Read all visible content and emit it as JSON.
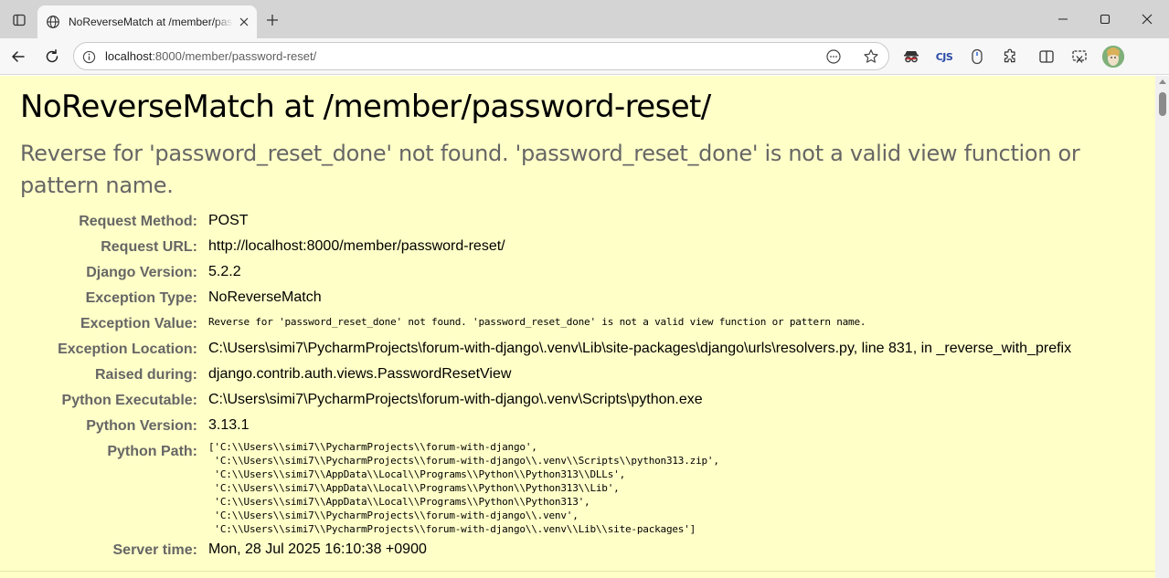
{
  "browser": {
    "tab": {
      "title": "NoReverseMatch at /member/password-reset/"
    },
    "address_bar": {
      "host": "localhost",
      "path": ":8000/member/password-reset/"
    },
    "icons": {
      "tab_actions": "tab-actions-icon",
      "favicon": "globe-icon",
      "close_tab": "close-icon",
      "new_tab": "plus-icon",
      "minimize": "minimize-icon",
      "maximize": "maximize-icon",
      "close_window": "close-icon",
      "back": "back-arrow-icon",
      "refresh": "refresh-icon",
      "info": "info-icon",
      "reader": "reader-mode-icon",
      "favorite": "star-icon",
      "extensions": "puzzle-icon",
      "split": "split-screen-icon",
      "screenshot": "screenshot-icon"
    },
    "extension_label": "CJS"
  },
  "error": {
    "title": "NoReverseMatch at /member/password-reset/",
    "message": "Reverse for 'password_reset_done' not found. 'password_reset_done' is not a valid view function or pattern name."
  },
  "meta": [
    {
      "key": "Request Method:",
      "value": "POST"
    },
    {
      "key": "Request URL:",
      "value": "http://localhost:8000/member/password-reset/"
    },
    {
      "key": "Django Version:",
      "value": "5.2.2"
    },
    {
      "key": "Exception Type:",
      "value": "NoReverseMatch"
    },
    {
      "key": "Exception Value:",
      "value": "Reverse for 'password_reset_done' not found. 'password_reset_done' is not a valid view function or pattern name."
    },
    {
      "key": "Exception Location:",
      "value": "C:\\Users\\simi7\\PycharmProjects\\forum-with-django\\.venv\\Lib\\site-packages\\django\\urls\\resolvers.py, line 831, in _reverse_with_prefix"
    },
    {
      "key": "Raised during:",
      "value": "django.contrib.auth.views.PasswordResetView"
    },
    {
      "key": "Python Executable:",
      "value": "C:\\Users\\simi7\\PycharmProjects\\forum-with-django\\.venv\\Scripts\\python.exe"
    },
    {
      "key": "Python Version:",
      "value": "3.13.1"
    },
    {
      "key": "Python Path:",
      "lines": [
        "['C:\\\\Users\\\\simi7\\\\PycharmProjects\\\\forum-with-django',",
        " 'C:\\\\Users\\\\simi7\\\\PycharmProjects\\\\forum-with-django\\\\.venv\\\\Scripts\\\\python313.zip',",
        " 'C:\\\\Users\\\\simi7\\\\AppData\\\\Local\\\\Programs\\\\Python\\\\Python313\\\\DLLs',",
        " 'C:\\\\Users\\\\simi7\\\\AppData\\\\Local\\\\Programs\\\\Python\\\\Python313\\\\Lib',",
        " 'C:\\\\Users\\\\simi7\\\\AppData\\\\Local\\\\Programs\\\\Python\\\\Python313',",
        " 'C:\\\\Users\\\\simi7\\\\PycharmProjects\\\\forum-with-django\\\\.venv',",
        " 'C:\\\\Users\\\\simi7\\\\PycharmProjects\\\\forum-with-django\\\\.venv\\\\Lib\\\\site-packages']"
      ]
    },
    {
      "key": "Server time:",
      "value": "Mon, 28 Jul 2025 16:10:38 +0900"
    }
  ]
}
